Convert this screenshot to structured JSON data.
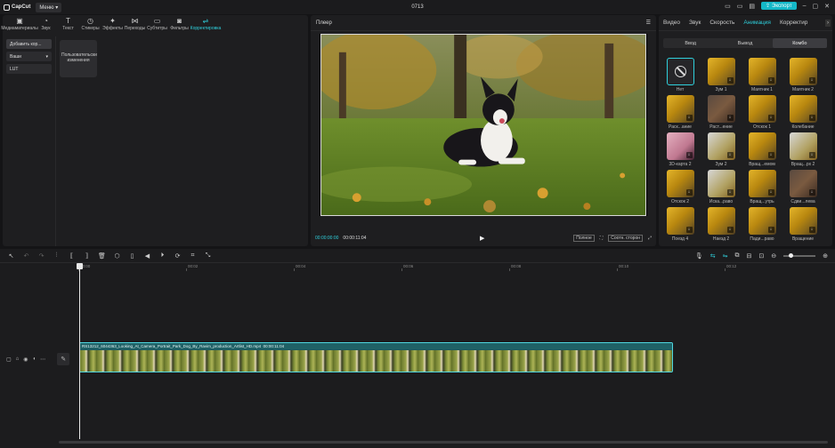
{
  "app": {
    "logo": "CapCut",
    "menu_label": "Меню",
    "project_title": "0713",
    "export_label": "Экспорт"
  },
  "media_tools": [
    {
      "label": "Медиаматериалы",
      "icon": "media-icon"
    },
    {
      "label": "Звук",
      "icon": "audio-icon"
    },
    {
      "label": "Текст",
      "icon": "text-icon"
    },
    {
      "label": "Стикеры",
      "icon": "sticker-icon"
    },
    {
      "label": "Эффекты",
      "icon": "effects-icon"
    },
    {
      "label": "Переходы",
      "icon": "transitions-icon"
    },
    {
      "label": "Субтитры",
      "icon": "subtitles-icon"
    },
    {
      "label": "Фильтры",
      "icon": "filters-icon"
    },
    {
      "label": "Корректировка",
      "icon": "adjust-icon"
    }
  ],
  "adjust_panel": {
    "add_button": "Добавить кор...",
    "dropdown": "Ваши",
    "lut": "LUT",
    "preset_card": "Пользовательские изменения"
  },
  "player": {
    "title": "Плеер",
    "current_time": "00:00:00:00",
    "total_time": "00:00:11:04",
    "full_label": "Полное",
    "ratio_label": "Соотн. сторон"
  },
  "properties": {
    "tabs": [
      "Видео",
      "Звук",
      "Скорость",
      "Анимация",
      "Корректир"
    ],
    "active_tab": "Анимация",
    "segments": [
      "Ввод",
      "Вывод",
      "Комбо"
    ],
    "active_segment": "Комбо",
    "animations": [
      {
        "label": "Нет",
        "style": "none"
      },
      {
        "label": "Зум 1",
        "style": "gold"
      },
      {
        "label": "Маятник 1",
        "style": "gold"
      },
      {
        "label": "Маятник 2",
        "style": "gold"
      },
      {
        "label": "Раск...ание",
        "style": "gold"
      },
      {
        "label": "Раст...ение",
        "style": "dark"
      },
      {
        "label": "Отскок 1",
        "style": "gold"
      },
      {
        "label": "Колебание",
        "style": "gold"
      },
      {
        "label": "3D-карта 2",
        "style": "pink"
      },
      {
        "label": "Зум 2",
        "style": "gray"
      },
      {
        "label": "Вращ...емом",
        "style": "gold"
      },
      {
        "label": "Вращ...рх 2",
        "style": "gray"
      },
      {
        "label": "Отскок 2",
        "style": "gold"
      },
      {
        "label": "Иска...раво",
        "style": "gray"
      },
      {
        "label": "Вращ...утрь",
        "style": "gold"
      },
      {
        "label": "Сдви...лева",
        "style": "dark"
      },
      {
        "label": "Поезд 4",
        "style": "gold"
      },
      {
        "label": "Наезд 2",
        "style": "gold"
      },
      {
        "label": "Пади...раво",
        "style": "gold"
      },
      {
        "label": "Вращение",
        "style": "gold"
      }
    ]
  },
  "timeline": {
    "ruler": [
      "00:00",
      "00:02",
      "00:04",
      "00:06",
      "00:08",
      "00:10",
      "00:12"
    ],
    "clip_name": "RS13212_6044363_Looking_At_Camera_Portrait_Park_Dog_By_Ravim_production_Artlist_HD.mp4",
    "clip_duration": "00:00:11:04"
  }
}
